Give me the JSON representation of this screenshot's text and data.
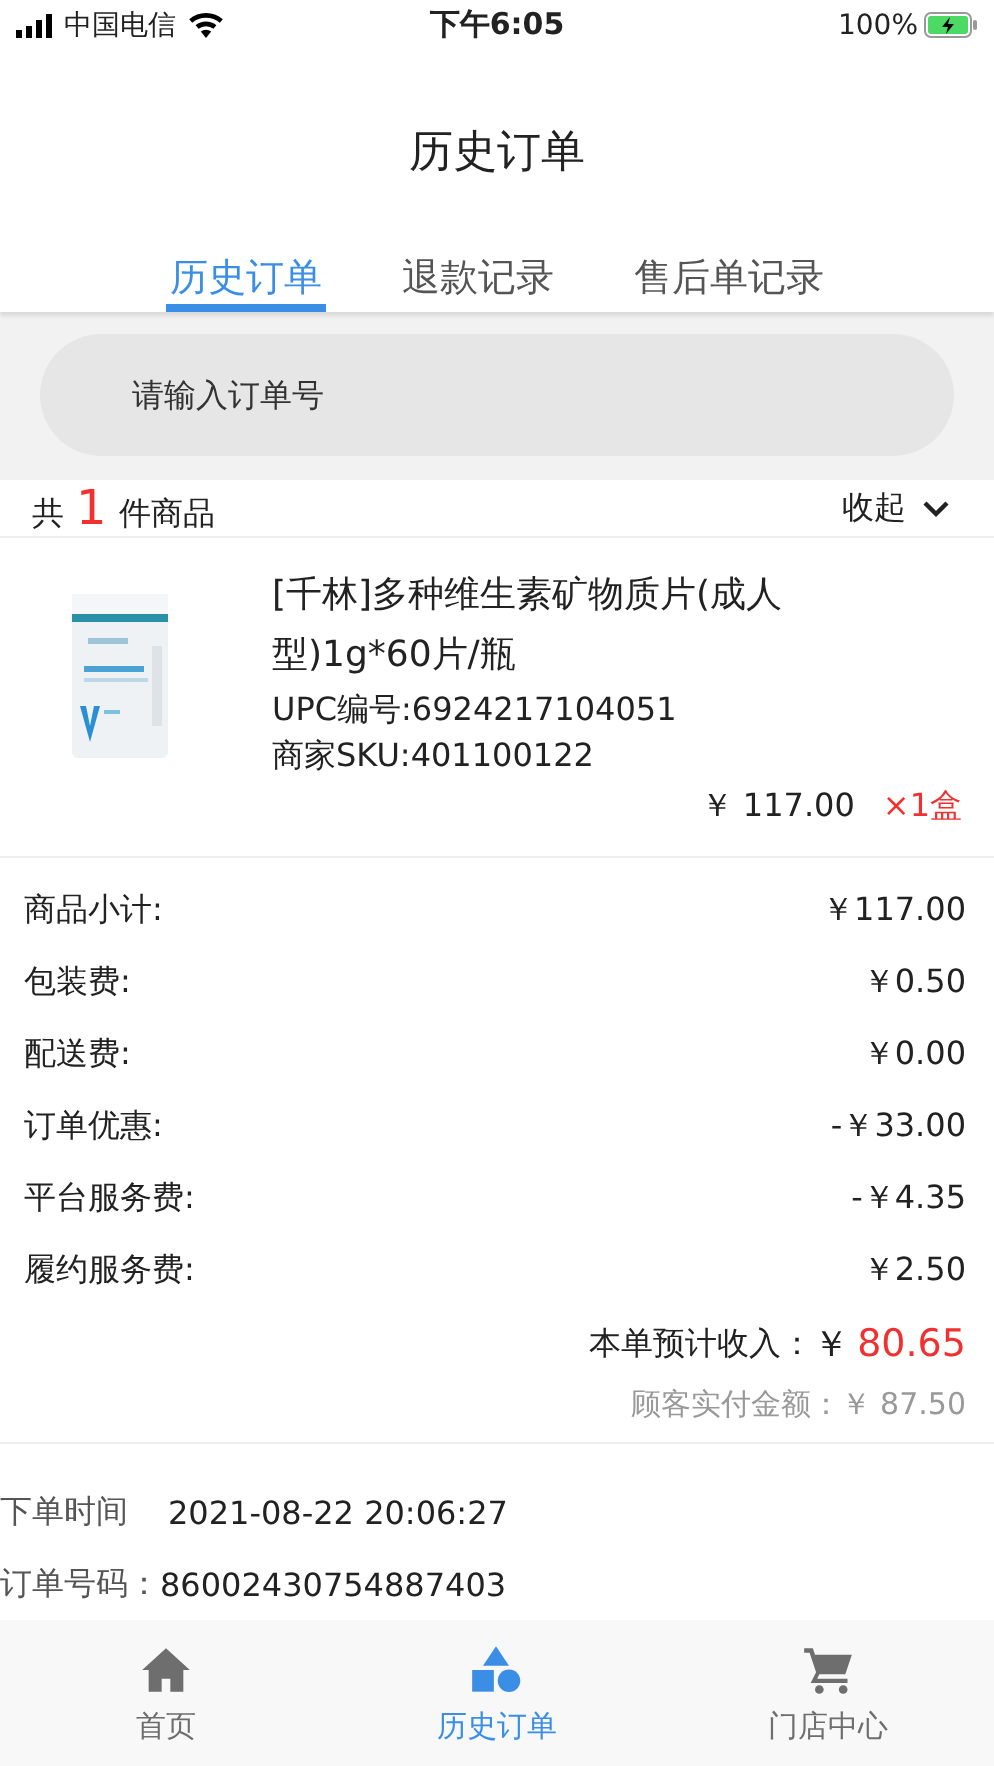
{
  "status_bar": {
    "carrier": "中国电信",
    "time": "下午6:05",
    "battery": "100%"
  },
  "title": "历史订单",
  "tabs": [
    {
      "label": "历史订单",
      "selected": true
    },
    {
      "label": "退款记录",
      "selected": false
    },
    {
      "label": "售后单记录",
      "selected": false
    }
  ],
  "search": {
    "placeholder": "请输入订单号"
  },
  "summary": {
    "prefix": "共",
    "count": "1",
    "suffix": "件商品",
    "toggle": "收起"
  },
  "products": [
    {
      "name": "[千林]多种维生素矿物质片(成人型)1g*60片/瓶",
      "upc": "UPC编号:6924217104051",
      "sku": "商家SKU:401100122",
      "price": "￥ 117.00",
      "quantity": "×1盒"
    }
  ],
  "fees": [
    {
      "label": "商品小计:",
      "value": "￥117.00"
    },
    {
      "label": "包装费:",
      "value": "￥0.50"
    },
    {
      "label": "配送费:",
      "value": "￥0.00"
    },
    {
      "label": "订单优惠:",
      "value": "-￥33.00"
    },
    {
      "label": "平台服务费:",
      "value": "-￥4.35"
    },
    {
      "label": "履约服务费:",
      "value": "￥2.50"
    }
  ],
  "income": {
    "label": "本单预计收入：",
    "currency": "￥",
    "amount": "80.65"
  },
  "paid": {
    "label": "顾客实付金额：",
    "value": "￥ 87.50"
  },
  "order_info": [
    {
      "label": "下单时间",
      "value": "2021-08-22 20:06:27"
    },
    {
      "label": "订单号码：",
      "value": "86002430754887403"
    }
  ],
  "bottom_nav": [
    {
      "label": "首页",
      "kind": "home",
      "selected": false
    },
    {
      "label": "历史订单",
      "kind": "shapes",
      "selected": true
    },
    {
      "label": "门店中心",
      "kind": "cart",
      "selected": false
    }
  ]
}
